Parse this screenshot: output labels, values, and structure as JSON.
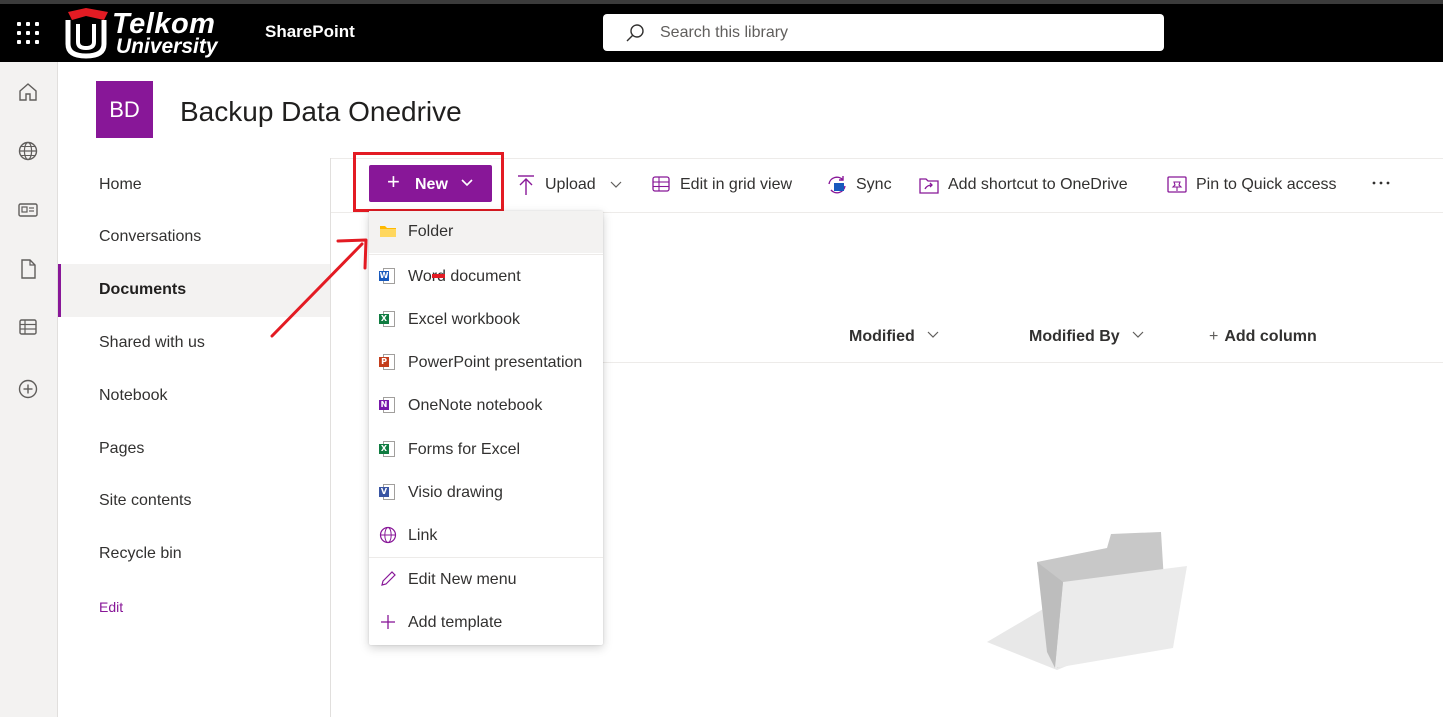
{
  "app": {
    "brand_line1": "Telkom",
    "brand_line2": "University",
    "name": "SharePoint"
  },
  "search": {
    "placeholder": "Search this library"
  },
  "site": {
    "logo_initials": "BD",
    "title": "Backup Data Onedrive",
    "accent": "#881798"
  },
  "nav": {
    "items": [
      {
        "label": "Home"
      },
      {
        "label": "Conversations"
      },
      {
        "label": "Documents",
        "active": true
      },
      {
        "label": "Shared with us"
      },
      {
        "label": "Notebook"
      },
      {
        "label": "Pages"
      },
      {
        "label": "Site contents"
      },
      {
        "label": "Recycle bin"
      }
    ],
    "edit_label": "Edit"
  },
  "commandbar": {
    "new_label": "New",
    "upload_label": "Upload",
    "grid_label": "Edit in grid view",
    "sync_label": "Sync",
    "shortcut_label": "Add shortcut to OneDrive",
    "pin_label": "Pin to Quick access",
    "more_icon": "more-icon"
  },
  "columns": {
    "modified": "Modified",
    "modified_by": "Modified By",
    "add_column": "Add column"
  },
  "new_menu": {
    "items": [
      {
        "label": "Folder",
        "icon": "folder-icon"
      },
      {
        "label": "Word document",
        "icon": "word-icon",
        "badge": "W",
        "color": "#185abd"
      },
      {
        "label": "Excel workbook",
        "icon": "excel-icon",
        "badge": "X",
        "color": "#107c41"
      },
      {
        "label": "PowerPoint presentation",
        "icon": "powerpoint-icon",
        "badge": "P",
        "color": "#c43e1c"
      },
      {
        "label": "OneNote notebook",
        "icon": "onenote-icon",
        "badge": "N",
        "color": "#7719aa"
      },
      {
        "label": "Forms for Excel",
        "icon": "forms-excel-icon",
        "badge": "X",
        "color": "#107c41"
      },
      {
        "label": "Visio drawing",
        "icon": "visio-icon",
        "badge": "V",
        "color": "#3955a3"
      },
      {
        "label": "Link",
        "icon": "globe-icon"
      }
    ],
    "edit_label": "Edit New menu",
    "template_label": "Add template"
  },
  "annotation": {
    "color": "#e31b23"
  }
}
